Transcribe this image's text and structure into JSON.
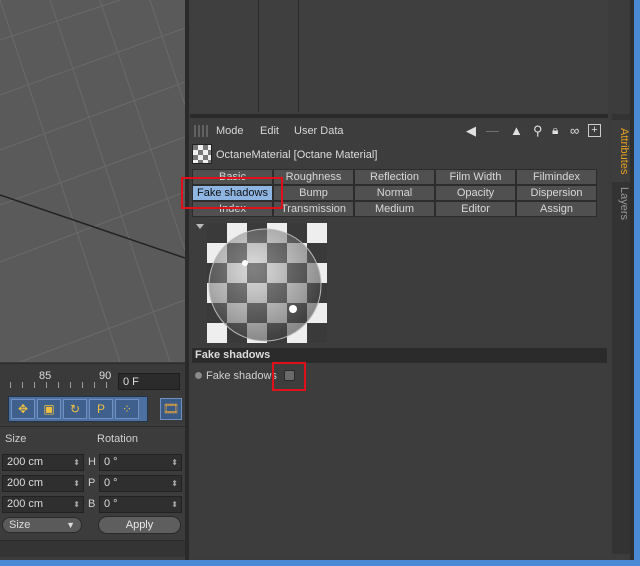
{
  "timeline": {
    "ruler_labels": [
      "85",
      "90"
    ],
    "frame_value": "0 F"
  },
  "tools": {
    "icons": [
      "move-icon",
      "scale-icon",
      "rotate-icon",
      "parking-icon",
      "points-icon"
    ],
    "glyphs": [
      "✥",
      "▣",
      "↻",
      "P",
      "⁘"
    ],
    "film_glyph": "🎞"
  },
  "coords": {
    "size_header": "Size",
    "rotation_header": "Rotation",
    "size_values": [
      "200 cm",
      "200 cm",
      "200 cm"
    ],
    "rotation_axes": [
      "H",
      "P",
      "B"
    ],
    "rotation_values": [
      "0 °",
      "0 °",
      "0 °"
    ],
    "mode_dropdown": "Size",
    "apply_label": "Apply"
  },
  "attributes": {
    "menu": [
      "Mode",
      "Edit",
      "User Data"
    ],
    "material_title": "OctaneMaterial [Octane Material]",
    "tabs": [
      [
        "Basic",
        "Roughness",
        "Reflection",
        "Film Width",
        "Filmindex"
      ],
      [
        "Fake shadows",
        "Bump",
        "Normal",
        "Opacity",
        "Dispersion"
      ],
      [
        "Index",
        "Transmission",
        "Medium",
        "Editor",
        "Assign"
      ]
    ],
    "active_tab": "Fake shadows",
    "section_title": "Fake shadows",
    "param_label": "Fake shadows",
    "param_checked": false
  },
  "side_tabs": [
    "Attributes",
    "Layers"
  ],
  "colors": {
    "active_tab": "#8fb6e3",
    "highlight_box": "#e0101a",
    "attributes_tab_text": "#e8a020"
  }
}
